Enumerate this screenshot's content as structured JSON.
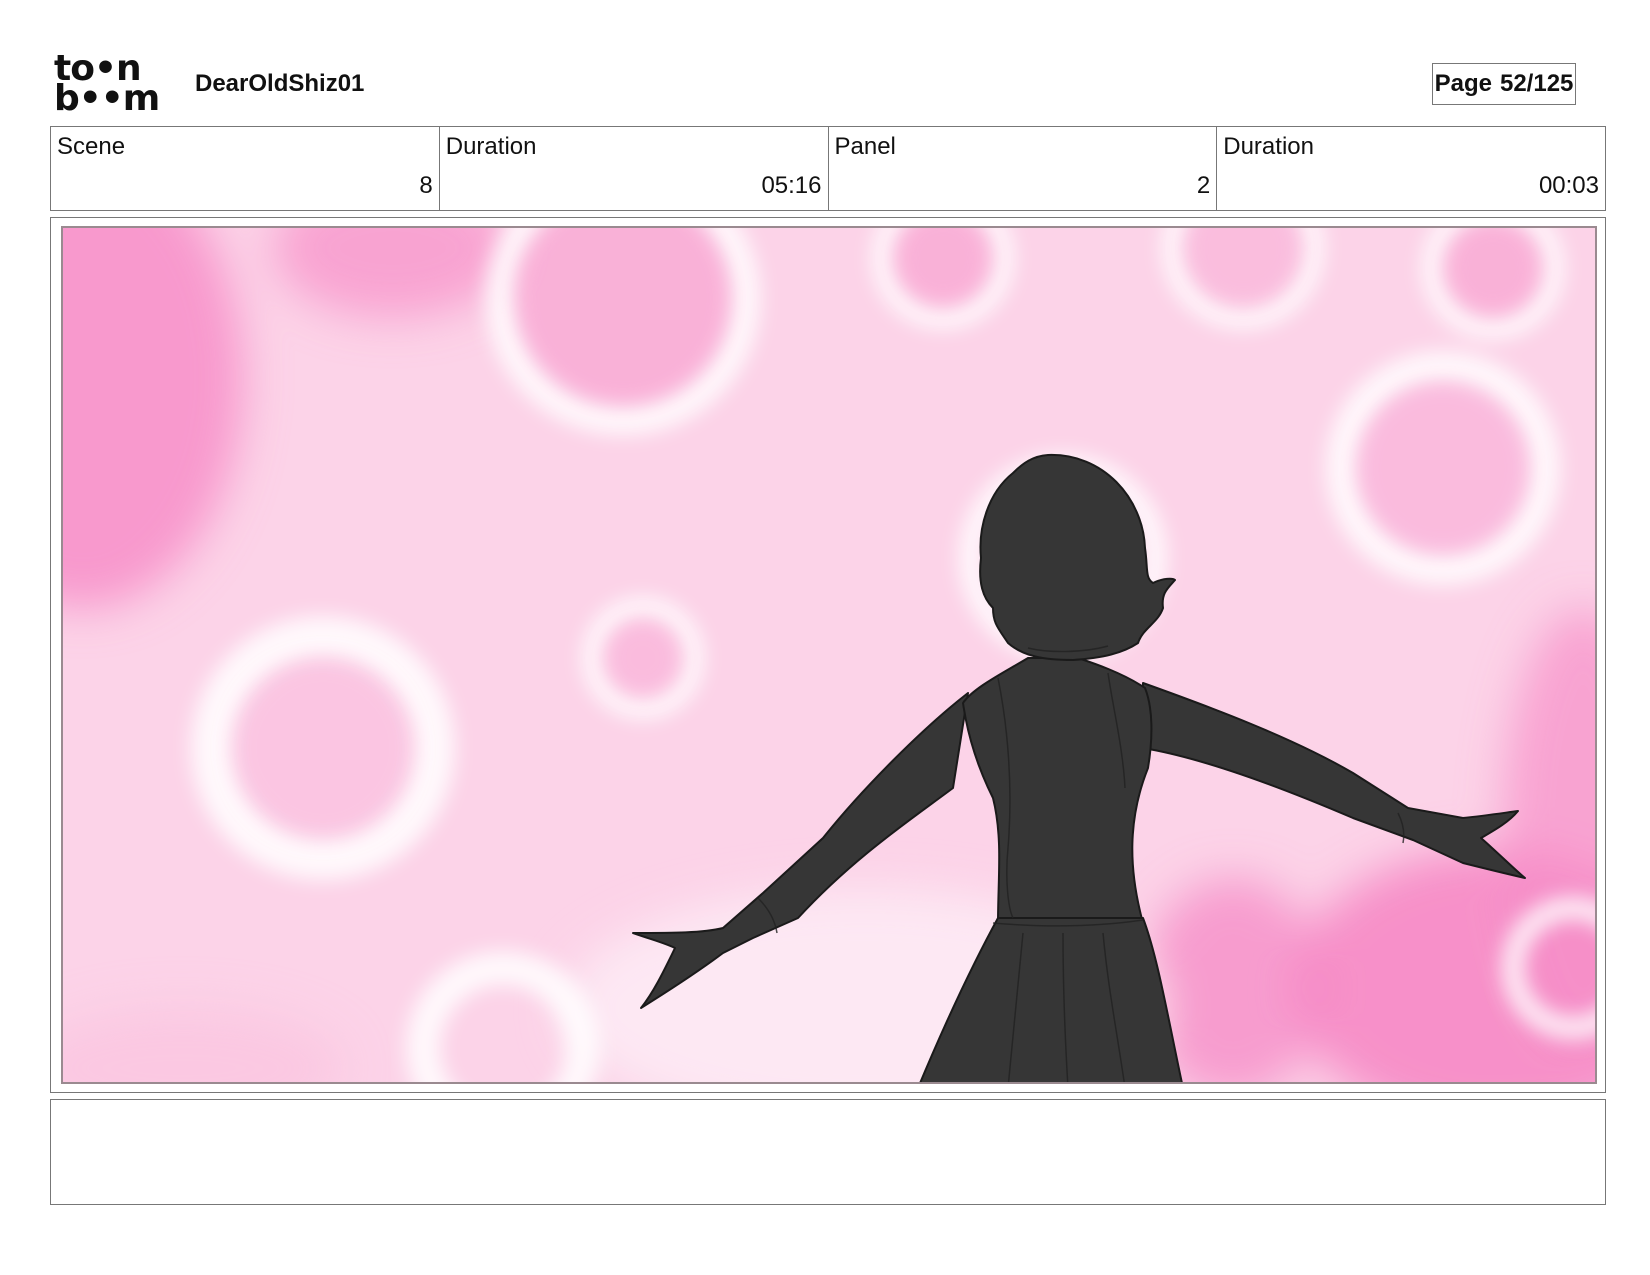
{
  "header": {
    "logo_line1": "to•n",
    "logo_line2": "b••m",
    "project_title": "DearOldShiz01",
    "page_label": "Page",
    "page_number": "52/125"
  },
  "info": {
    "scene_label": "Scene",
    "scene_value": "8",
    "scene_duration_label": "Duration",
    "scene_duration_value": "05:16",
    "panel_label": "Panel",
    "panel_value": "2",
    "panel_duration_label": "Duration",
    "panel_duration_value": "00:03"
  },
  "colors": {
    "background_pink": "#fcd3e8",
    "bokeh_pink": "#f790c9",
    "silhouette": "#363636",
    "frame_border": "#777777"
  },
  "notes": {
    "text": ""
  }
}
